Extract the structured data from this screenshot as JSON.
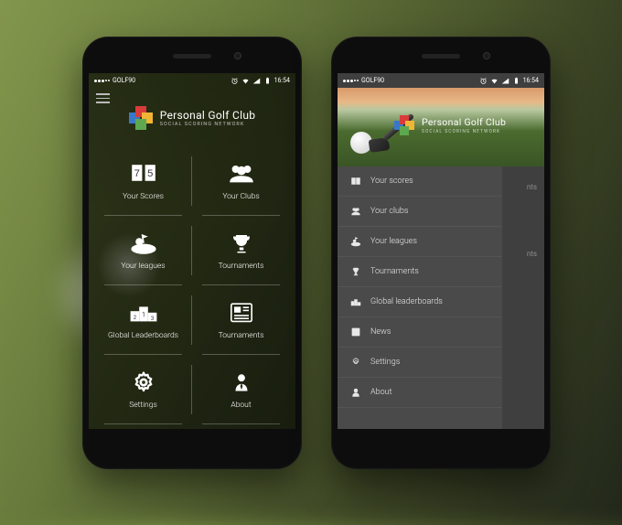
{
  "status": {
    "carrier": "GOLF90",
    "time": "16:54"
  },
  "brand": {
    "title": "Personal Golf Club",
    "tagline": "SOCIAL SCORING NETWORK"
  },
  "grid": [
    {
      "label": "Your Scores",
      "icon": "scores"
    },
    {
      "label": "Your Clubs",
      "icon": "clubs"
    },
    {
      "label": "Your leagues",
      "icon": "leagues"
    },
    {
      "label": "Tournaments",
      "icon": "trophy"
    },
    {
      "label": "Global Leaderboards",
      "icon": "podium"
    },
    {
      "label": "Tournaments",
      "icon": "news"
    },
    {
      "label": "Settings",
      "icon": "gear"
    },
    {
      "label": "About",
      "icon": "person"
    }
  ],
  "drawer": [
    {
      "label": "Your scores",
      "icon": "scores"
    },
    {
      "label": "Your clubs",
      "icon": "clubs"
    },
    {
      "label": "Your leagues",
      "icon": "leagues"
    },
    {
      "label": "Tournaments",
      "icon": "trophy"
    },
    {
      "label": "Global leaderboards",
      "icon": "podium"
    },
    {
      "label": "News",
      "icon": "news"
    },
    {
      "label": "Settings",
      "icon": "gear"
    },
    {
      "label": "About",
      "icon": "person"
    }
  ],
  "bgRight": {
    "a": "nts",
    "b": "nts"
  }
}
